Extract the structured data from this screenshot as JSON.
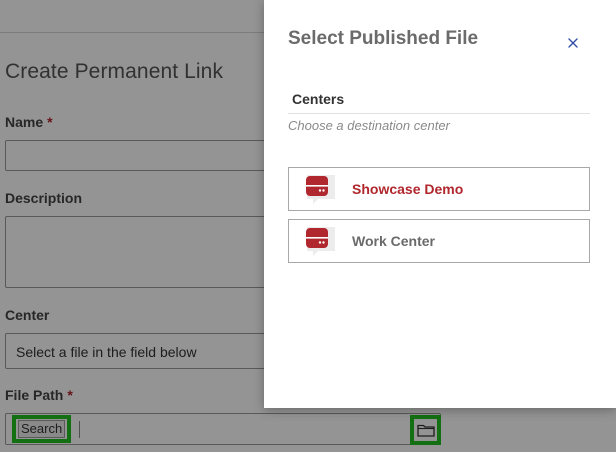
{
  "background_form": {
    "title": "Create Permanent Link",
    "name_label": "Name",
    "description_label": "Description",
    "center_label": "Center",
    "center_placeholder": "Select a file in the field below",
    "file_path_label": "File Path",
    "required_mark": "*",
    "search_tag": "Search"
  },
  "modal": {
    "title": "Select Published File",
    "section_title": "Centers",
    "section_hint": "Choose a destination center",
    "centers": [
      {
        "label": "Showcase Demo",
        "state": "active"
      },
      {
        "label": "Work Center",
        "state": "inactive"
      }
    ]
  },
  "colors": {
    "accent": "#b0272e",
    "highlight": "#22c11f",
    "close_icon": "#2f4fa8"
  },
  "icons": {
    "close": "close-icon",
    "folder": "folder-icon",
    "center": "server-center-icon"
  }
}
